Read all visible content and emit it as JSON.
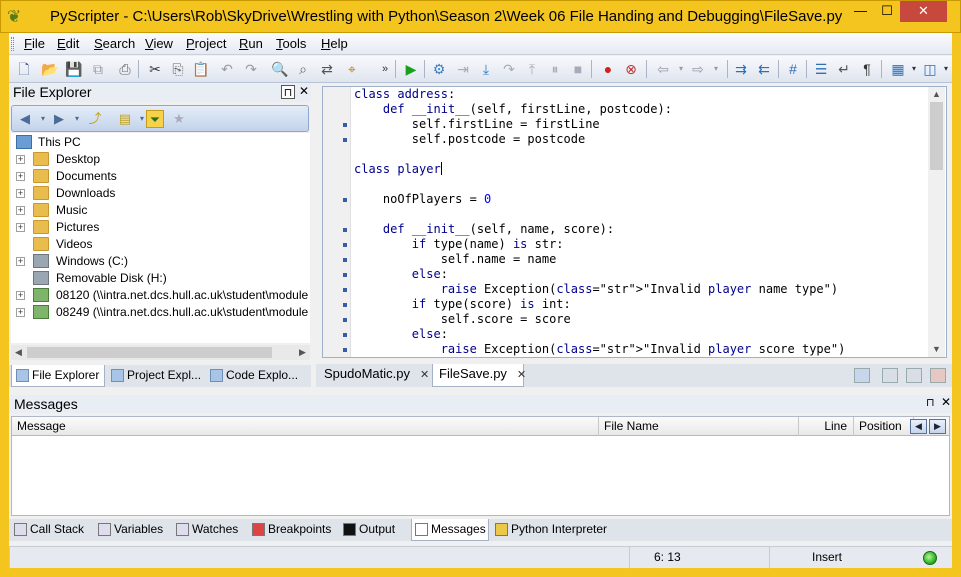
{
  "window": {
    "title": "PyScripter - C:\\Users\\Rob\\SkyDrive\\Wrestling with Python\\Season 2\\Week 06 File Handing and Debugging\\FileSave.py",
    "min": "—",
    "max": "☐",
    "close": "✕"
  },
  "menu": [
    "File",
    "Edit",
    "Search",
    "View",
    "Project",
    "Run",
    "Tools",
    "Help"
  ],
  "file_explorer": {
    "title": "File Explorer",
    "pin": "⊓",
    "close": "✕",
    "tree": [
      {
        "label": "This PC",
        "icon": "pc",
        "root": true
      },
      {
        "label": "Desktop",
        "icon": "folder"
      },
      {
        "label": "Documents",
        "icon": "folder"
      },
      {
        "label": "Downloads",
        "icon": "folder"
      },
      {
        "label": "Music",
        "icon": "folder"
      },
      {
        "label": "Pictures",
        "icon": "folder"
      },
      {
        "label": "Videos",
        "icon": "folder",
        "noexp": true
      },
      {
        "label": "Windows (C:)",
        "icon": "drive"
      },
      {
        "label": "Removable Disk (H:)",
        "icon": "drive",
        "noexp": true
      },
      {
        "label": "08120 (\\\\intra.net.dcs.hull.ac.uk\\student\\module",
        "icon": "net"
      },
      {
        "label": "08249 (\\\\intra.net.dcs.hull.ac.uk\\student\\module",
        "icon": "net"
      }
    ],
    "tabs": [
      "File Explorer",
      "Project Expl...",
      "Code Explo..."
    ]
  },
  "editor": {
    "lines": [
      "class address:",
      "    def __init__(self, firstLine, postcode):",
      "        self.firstLine = firstLine",
      "        self.postcode = postcode",
      "",
      "class player",
      "",
      "    noOfPlayers = 0",
      "",
      "    def __init__(self, name, score):",
      "        if type(name) is str:",
      "            self.name = name",
      "        else:",
      "            raise Exception(\"Invalid player name type\")",
      "        if type(score) is int:",
      "            self.score = score",
      "        else:",
      "            raise Exception(\"Invalid player score type\")"
    ],
    "tabs": [
      "SpudoMatic.py",
      "FileSave.py"
    ],
    "active_tab": "FileSave.py",
    "tab_close": "✕"
  },
  "messages": {
    "title": "Messages",
    "pin": "⊓",
    "close": "✕",
    "columns": [
      "Message",
      "File Name",
      "Line",
      "Position"
    ]
  },
  "bottom_tabs": [
    "Call Stack",
    "Variables",
    "Watches",
    "Breakpoints",
    "Output",
    "Messages",
    "Python Interpreter"
  ],
  "status": {
    "position": "6: 13",
    "mode": "Insert"
  }
}
